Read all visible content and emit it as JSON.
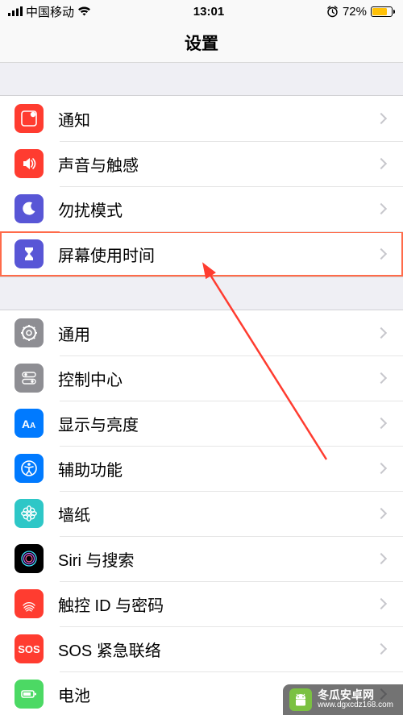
{
  "status": {
    "carrier": "中国移动",
    "time": "13:01",
    "battery_pct": "72%"
  },
  "nav": {
    "title": "设置"
  },
  "rows": {
    "notify": "通知",
    "sound": "声音与触感",
    "dnd": "勿扰模式",
    "screentime": "屏幕使用时间",
    "general": "通用",
    "control": "控制中心",
    "display": "显示与亮度",
    "access": "辅助功能",
    "wallpaper": "墙纸",
    "siri": "Siri 与搜索",
    "touchid": "触控 ID 与密码",
    "sos": "SOS 紧急联络",
    "battery": "电池"
  },
  "sos_label": "SOS",
  "watermark": {
    "line1": "冬瓜安卓网",
    "line2": "www.dgxcdz168.com"
  }
}
